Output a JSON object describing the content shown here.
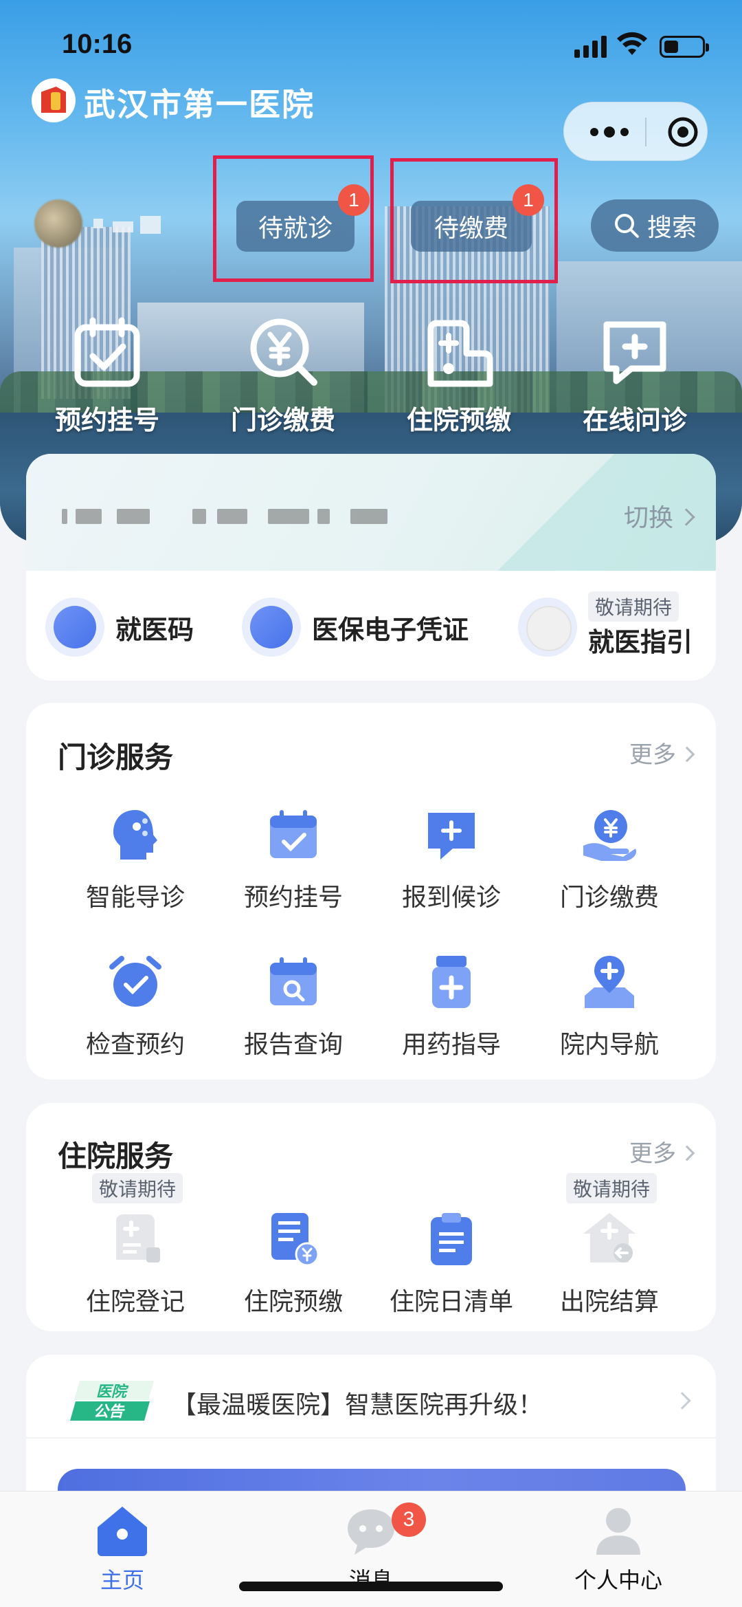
{
  "status_bar": {
    "time": "10:16"
  },
  "header": {
    "app_title": "武汉市第一医院"
  },
  "profile": {
    "chips": [
      {
        "label": "待就诊",
        "badge": "1"
      },
      {
        "label": "待缴费",
        "badge": "1"
      }
    ],
    "search_label": "搜索"
  },
  "quick_actions": [
    {
      "label": "预约挂号",
      "icon": "calendar-check-icon"
    },
    {
      "label": "门诊缴费",
      "icon": "yuan-search-icon"
    },
    {
      "label": "住院预缴",
      "icon": "hospital-bed-icon"
    },
    {
      "label": "在线问诊",
      "icon": "chat-plus-icon"
    }
  ],
  "patient_card": {
    "switch_label": "切换",
    "items": [
      {
        "label": "就医码",
        "icon": "qr-code-icon"
      },
      {
        "label": "医保电子凭证",
        "icon": "insurance-card-icon"
      },
      {
        "label": "就医指引",
        "icon": "compass-icon",
        "tag": "敬请期待"
      }
    ]
  },
  "outpatient": {
    "title": "门诊服务",
    "more": "更多",
    "items": [
      {
        "label": "智能导诊",
        "icon": "head-ai-icon"
      },
      {
        "label": "预约挂号",
        "icon": "calendar-check-icon"
      },
      {
        "label": "报到候诊",
        "icon": "chat-plus-icon"
      },
      {
        "label": "门诊缴费",
        "icon": "hand-yuan-icon"
      },
      {
        "label": "检查预约",
        "icon": "alarm-clock-icon"
      },
      {
        "label": "报告查询",
        "icon": "calendar-search-icon"
      },
      {
        "label": "用药指导",
        "icon": "medicine-bottle-icon"
      },
      {
        "label": "院内导航",
        "icon": "map-pin-icon"
      }
    ]
  },
  "inpatient": {
    "title": "住院服务",
    "more": "更多",
    "items": [
      {
        "label": "住院登记",
        "icon": "register-doc-icon",
        "tag": "敬请期待"
      },
      {
        "label": "住院预缴",
        "icon": "bill-yuan-icon"
      },
      {
        "label": "住院日清单",
        "icon": "clipboard-list-icon"
      },
      {
        "label": "出院结算",
        "icon": "house-exit-icon",
        "tag": "敬请期待"
      }
    ]
  },
  "notice": {
    "tag_top": "医院",
    "tag_bottom": "公告",
    "text": "【最温暖医院】智慧医院再升级！"
  },
  "tabbar": {
    "tabs": [
      {
        "label": "主页",
        "icon": "home-icon",
        "active": true
      },
      {
        "label": "消息",
        "icon": "message-icon",
        "badge": "3"
      },
      {
        "label": "个人中心",
        "icon": "user-icon"
      }
    ]
  },
  "colors": {
    "accent": "#3f72e8",
    "badge": "#f05545",
    "highlight_box": "#e0204a"
  }
}
